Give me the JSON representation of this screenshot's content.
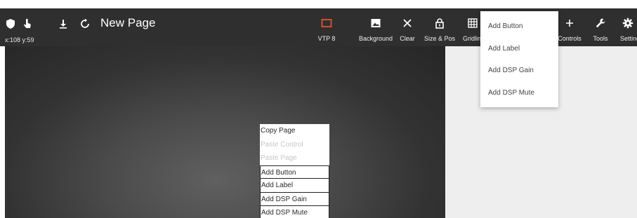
{
  "header": {
    "page_title": "New Page",
    "coords": "x:108 y:59"
  },
  "toolbar": {
    "left_icons": [
      {
        "icon": "shield-icon"
      },
      {
        "icon": "touch-hand-icon"
      },
      {
        "icon": "download-icon"
      },
      {
        "icon": "refresh-icon"
      }
    ],
    "tools": [
      {
        "icon": "panel-outline-icon",
        "label": "VTP 8",
        "icon_color": "#e8502a"
      },
      {
        "icon": "image-icon",
        "label": "Background"
      },
      {
        "icon": "close-icon",
        "label": "Clear"
      },
      {
        "icon": "lock-icon",
        "label": "Size & Pos"
      },
      {
        "icon": "grid-icon",
        "label": "Gridlin"
      },
      {
        "icon": "plus-icon",
        "label": "Controls"
      },
      {
        "icon": "wrench-icon",
        "label": "Tools"
      },
      {
        "icon": "gear-icon",
        "label": "Setting"
      }
    ]
  },
  "add_dropdown": {
    "items": [
      "Add Button",
      "Add Label",
      "Add DSP Gain",
      "Add DSP Mute"
    ]
  },
  "context_menu": {
    "items": [
      {
        "label": "Copy Page",
        "enabled": true
      },
      {
        "label": "Paste Control",
        "enabled": false
      },
      {
        "label": "Paste Page",
        "enabled": false
      },
      {
        "label": "Add Button",
        "enabled": true
      },
      {
        "label": "Add Label",
        "enabled": true
      },
      {
        "label": "Add DSP Gain",
        "enabled": true
      },
      {
        "label": "Add DSP Mute",
        "enabled": true
      }
    ]
  },
  "colors": {
    "toolbar_bg": "#2f2f2f",
    "accent": "#e8502a",
    "right_pane_bg": "#eeeeee"
  }
}
